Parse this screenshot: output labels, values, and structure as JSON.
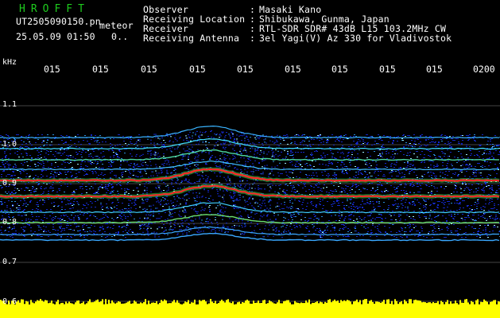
{
  "app": {
    "title": "HROFFT",
    "file_name": "UT2505090150.pn",
    "file_suffix": "meteor",
    "timestamp": "25.05.09 01:50",
    "timestamp_extra": "0.."
  },
  "header": {
    "rows": [
      {
        "label": "Observer",
        "sep": ":",
        "value": "Masaki Kano"
      },
      {
        "label": "Receiving Location",
        "sep": ":",
        "value": "Shibukawa, Gunma, Japan"
      },
      {
        "label": "Receiver",
        "sep": ":",
        "value": "RTL-SDR SDR# 43dB L15 103.2MHz CW"
      },
      {
        "label": "Receiving Antenna",
        "sep": ":",
        "value": "3el Yagi(V) Az 330 for Vladivostok"
      }
    ]
  },
  "time_axis": {
    "ticks": [
      "015",
      "015",
      "015",
      "015",
      "015",
      "015",
      "015",
      "015",
      "015",
      "0200"
    ]
  },
  "freq_axis": {
    "unit": "kHz",
    "labels": [
      "1.1",
      "1.0",
      "0.9",
      "0.8",
      "0.7",
      "0.6"
    ]
  },
  "colors": {
    "title": "#1ecb1e",
    "spectrum_background": "#000000",
    "noise_blue": "#1428c8",
    "signal_red": "#ff2828",
    "signal_green": "#40ff60",
    "level_yellow": "#ffff00"
  }
}
